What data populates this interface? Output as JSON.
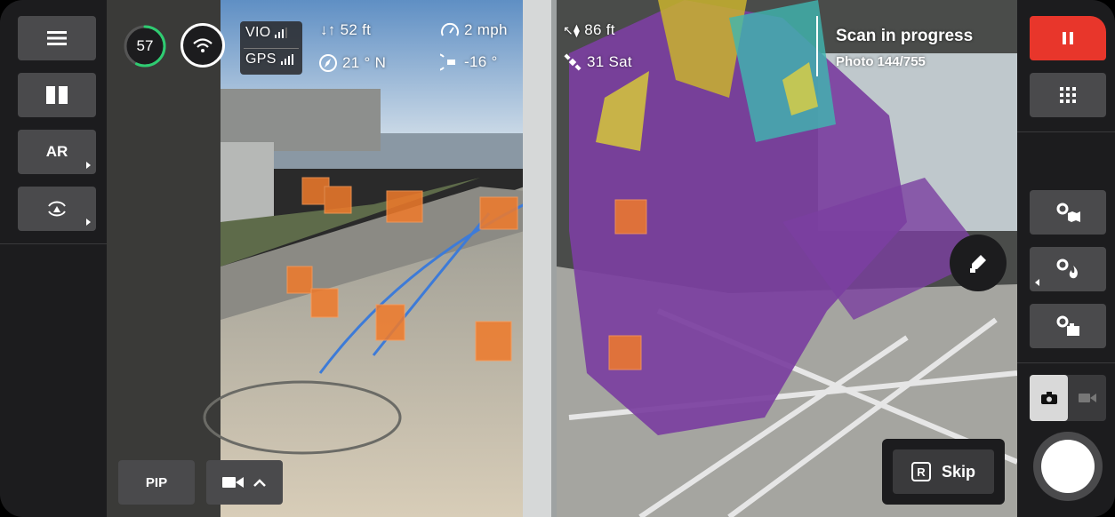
{
  "battery": {
    "percent": "57",
    "level": 0.57,
    "color": "#2ecc71"
  },
  "telemetry": {
    "vio": "VIO",
    "gps": "GPS",
    "height": "52 ft",
    "speed": "2 mph",
    "heading": "21 ° N",
    "tilt": "-16 °",
    "distance": "86 ft",
    "satellites": "31 Sat"
  },
  "scan": {
    "title": "Scan in progress",
    "subtitle": "Photo 144/755"
  },
  "left_menu": {
    "ar_label": "AR"
  },
  "bottom": {
    "pip_label": "PIP",
    "skip_key": "R",
    "skip_label": "Skip"
  },
  "colors": {
    "record_red": "#e8362b",
    "accent_orange": "#f07a2a",
    "mesh_purple": "#7b3fa0"
  }
}
